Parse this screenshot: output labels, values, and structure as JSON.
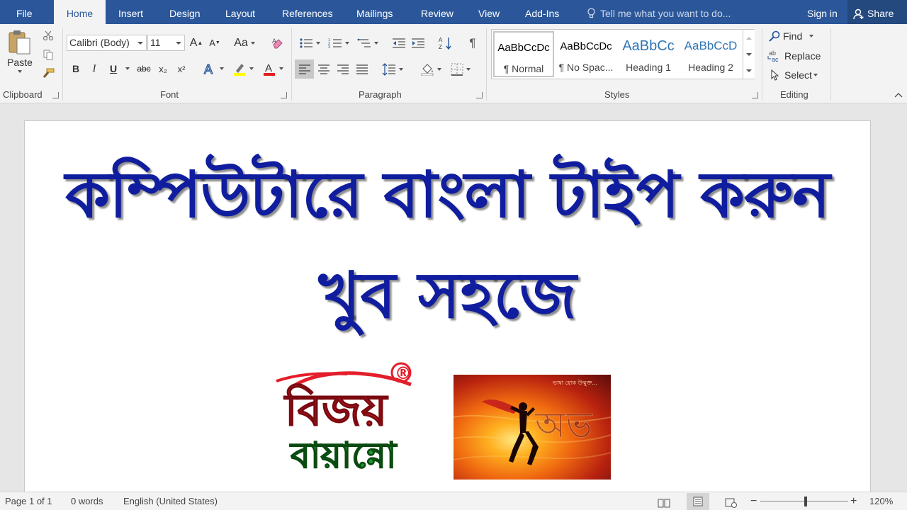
{
  "tabs": [
    "File",
    "Home",
    "Insert",
    "Design",
    "Layout",
    "References",
    "Mailings",
    "Review",
    "View",
    "Add-Ins"
  ],
  "tell_me": "Tell me what you want to do...",
  "sign_in": "Sign in",
  "share": "Share",
  "clipboard": {
    "paste": "Paste",
    "label": "Clipboard"
  },
  "font": {
    "name": "Calibri (Body)",
    "size": "11",
    "case_btn": "Aa",
    "label": "Font",
    "bold": "B",
    "italic": "I",
    "underline": "U",
    "strike": "abc",
    "sub": "x₂",
    "sup": "x²"
  },
  "paragraph": {
    "label": "Paragraph"
  },
  "styles": {
    "label": "Styles",
    "items": [
      {
        "preview": "AaBbCcDc",
        "name": "¶ Normal"
      },
      {
        "preview": "AaBbCcDc",
        "name": "¶ No Spac..."
      },
      {
        "preview": "AaBbCc",
        "name": "Heading 1"
      },
      {
        "preview": "AaBbCcD",
        "name": "Heading 2"
      }
    ]
  },
  "editing": {
    "find": "Find",
    "replace": "Replace",
    "select": "Select",
    "label": "Editing"
  },
  "document": {
    "line1": "কম্পিউটারে বাংলা টাইপ করুন",
    "line2": "খুব সহজে",
    "logo_top": "বিজয়",
    "logo_bottom": "বায়ান্নো",
    "logo_mark": "®",
    "photo_caption": "ভাষা হোক উন্মুক্ত...",
    "photo_letters": "অভ"
  },
  "status": {
    "page": "Page 1 of 1",
    "words": "0 words",
    "language": "English (United States)",
    "zoom": "120%"
  },
  "colors": {
    "ribbon_blue": "#2b579a",
    "heading_blue": "#0f1d9e",
    "logo_red": "#e41e2b",
    "logo_green": "#1a9a2a"
  }
}
